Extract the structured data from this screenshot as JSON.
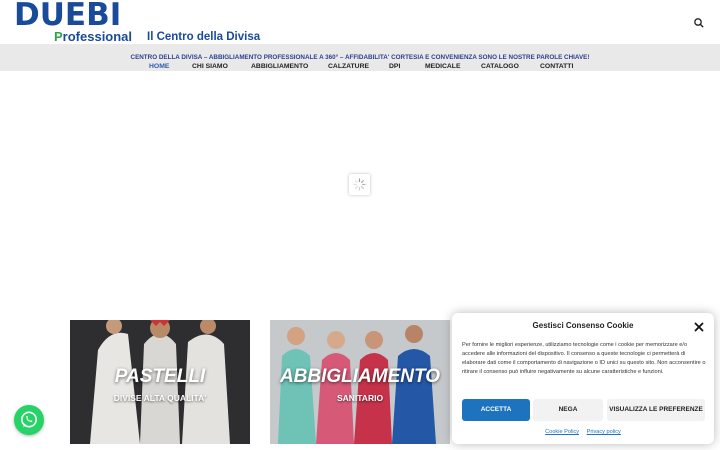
{
  "header": {
    "logo_main": "DUEBI",
    "logo_sub_first": "P",
    "logo_sub_rest": "rofessional",
    "tagline": "Il Centro della Divisa",
    "search_icon": "search-icon"
  },
  "nav": {
    "slogan": "CENTRO DELLA DIVISA – ABBIGLIAMENTO PROFESSIONALE A 360° – AFFIDABILITA' CORTESIA E CONVENIENZA SONO LE NOSTRE PAROLE CHIAVE!",
    "items": [
      {
        "label": "HOME",
        "active": true
      },
      {
        "label": "CHI SIAMO",
        "active": false
      },
      {
        "label": "ABBIGLIAMENTO",
        "active": false
      },
      {
        "label": "CALZATURE",
        "active": false
      },
      {
        "label": "DPI",
        "active": false
      },
      {
        "label": "MEDICALE",
        "active": false
      },
      {
        "label": "CATALOGO",
        "active": false
      },
      {
        "label": "CONTATTI",
        "active": false
      }
    ]
  },
  "cards": [
    {
      "title": "PASTELLI",
      "subtitle": "DIVISE ALTA QUALITA'"
    },
    {
      "title": "ABBIGLIAMENTO",
      "subtitle": "SANITARIO"
    }
  ],
  "cookie": {
    "title": "Gestisci Consenso Cookie",
    "text": "Per fornire le migliori esperienze, utilizziamo tecnologie come i cookie per memorizzare e/o accedere alle informazioni del dispositivo. Il consenso a queste tecnologie ci permetterà di elaborare dati come il comportamento di navigazione o ID unici su questo sito. Non acconsentire o ritirare il consenso può influire negativamente su alcune caratteristiche e funzioni.",
    "accept_label": "ACCETTA",
    "deny_label": "NEGA",
    "prefs_label": "VISUALIZZA LE PREFERENZE",
    "policy_link": "Cookie Policy",
    "privacy_link": "Privacy policy"
  },
  "colors": {
    "brand_blue": "#1a4a9a",
    "brand_green": "#2fa44f",
    "accent_button": "#1e73be",
    "whatsapp": "#25d366"
  }
}
